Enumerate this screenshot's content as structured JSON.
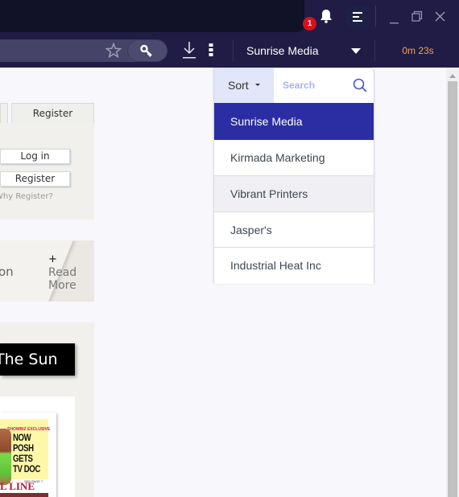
{
  "titlebar": {
    "notification_count": "1",
    "icons": {
      "bell": "bell-icon",
      "menu": "hamburger-menu-icon",
      "minimize": "minimize-icon",
      "restore": "restore-icon",
      "close": "close-icon"
    }
  },
  "toolbar": {
    "icons": {
      "bookmark": "star-icon",
      "password": "key-icon",
      "downloads": "download-icon",
      "more": "kebab-menu-icon"
    },
    "company_selected": "Sunrise Media",
    "timer": "0m 23s"
  },
  "page": {
    "tabs": [
      "Register"
    ],
    "login_button": "Log in",
    "register_button": "Register",
    "why_register": "Why Register?",
    "read_more_partial": "on",
    "read_more_plus": "+",
    "read_more_line1": "Read",
    "read_more_line2": "More",
    "sun_button": "The Sun",
    "newspaper": {
      "exclusive": "SHOWBIZ EXCLUSIVE",
      "headline": [
        "NOW",
        "POSH",
        "GETS",
        "TV DOC"
      ],
      "see_page": "SEE PAGE 7",
      "masthead_partial": "L LINE"
    }
  },
  "dropdown": {
    "sort_label": "Sort",
    "search_placeholder": "Search",
    "items": [
      {
        "label": "Sunrise Media",
        "state": "selected"
      },
      {
        "label": "Kirmada Marketing",
        "state": "normal"
      },
      {
        "label": "Vibrant Printers",
        "state": "hover"
      },
      {
        "label": "Jasper's",
        "state": "normal"
      },
      {
        "label": "Industrial Heat Inc",
        "state": "normal"
      }
    ]
  },
  "colors": {
    "chrome_bg": "#201c45",
    "selected_item": "#2b2ea3",
    "timer": "#f0a05c",
    "badge": "#d8101c"
  }
}
